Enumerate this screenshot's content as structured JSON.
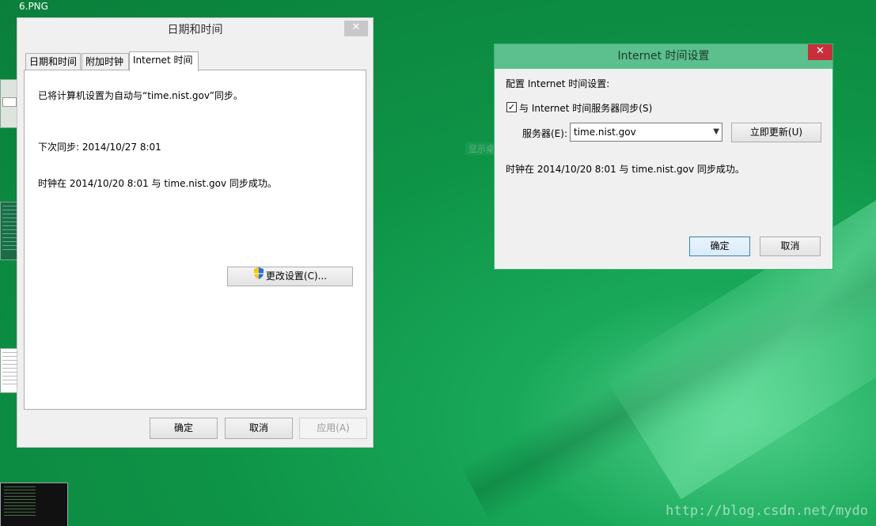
{
  "desktop": {
    "file_label": "6.PNG",
    "watermark": "http://blog.csdn.net/mydo",
    "ghost_text": "显示桌面(K)"
  },
  "date_time_window": {
    "title": "日期和时间",
    "close_glyph": "✕",
    "tabs": [
      {
        "label": "日期和时间",
        "active": false
      },
      {
        "label": "附加时钟",
        "active": false
      },
      {
        "label": "Internet 时间",
        "active": true
      }
    ],
    "panel": {
      "auto_sync_text": "已将计算机设置为自动与“time.nist.gov”同步。",
      "next_sync_text": "下次同步: 2014/10/27 8:01",
      "last_sync_text": "时钟在 2014/10/20 8:01 与 time.nist.gov 同步成功。",
      "change_settings_label": "更改设置(C)..."
    },
    "buttons": {
      "ok": "确定",
      "cancel": "取消",
      "apply": "应用(A)"
    }
  },
  "internet_time_window": {
    "title": "Internet 时间设置",
    "close_glyph": "✕",
    "config_heading": "配置 Internet 时间设置:",
    "sync_checkbox_label": "与 Internet 时间服务器同步(S)",
    "sync_checked": true,
    "check_glyph": "✓",
    "server_label": "服务器(E):",
    "server_value": "time.nist.gov",
    "update_now_label": "立即更新(U)",
    "status_text": "时钟在 2014/10/20 8:01 与 time.nist.gov 同步成功。",
    "buttons": {
      "ok": "确定",
      "cancel": "取消"
    }
  },
  "colors": {
    "desktop_green": "#0e9447",
    "active_title_bar": "#5bbf8e",
    "close_red": "#c7303a"
  }
}
